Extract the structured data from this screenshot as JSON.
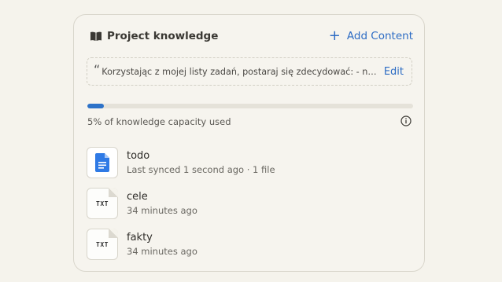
{
  "header": {
    "title": "Project knowledge",
    "book_icon": "book-icon",
    "add_label": "Add Content",
    "add_icon": "plus-icon"
  },
  "instructions": {
    "quote": "“",
    "text": "Korzystając z mojej listy zadań, postaraj się zdecydować: - na ...",
    "edit_label": "Edit"
  },
  "capacity": {
    "percent": 5,
    "label": "5% of knowledge capacity used",
    "accent": "#2d72c8",
    "info_icon": "info-icon"
  },
  "files": [
    {
      "name": "todo",
      "sub": "Last synced 1 second ago · 1 file",
      "kind": "google-doc-icon"
    },
    {
      "name": "cele",
      "sub": "34 minutes ago",
      "kind": "txt",
      "badge": "TXT"
    },
    {
      "name": "fakty",
      "sub": "34 minutes ago",
      "kind": "txt",
      "badge": "TXT"
    }
  ]
}
